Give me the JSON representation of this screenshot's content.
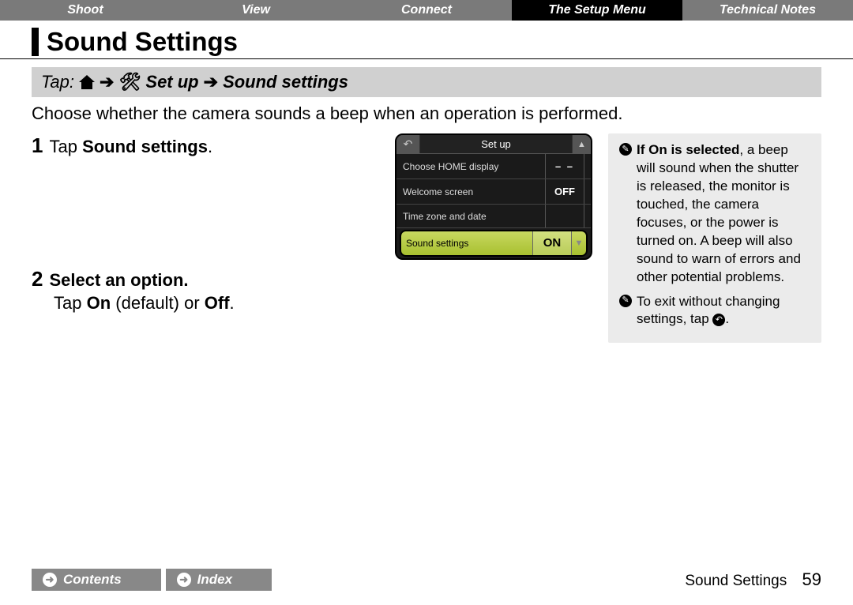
{
  "tabs": [
    "Shoot",
    "View",
    "Connect",
    "The Setup Menu",
    "Technical Notes"
  ],
  "active_tab": 3,
  "title": "Sound Settings",
  "path": {
    "prefix": "Tap:",
    "setup": "Set up",
    "target": "Sound settings"
  },
  "intro": "Choose whether the camera sounds a beep when an operation is performed.",
  "steps": [
    {
      "num": "1",
      "label_pre": "Tap ",
      "label_bold": "Sound settings",
      "label_post": "."
    },
    {
      "num": "2",
      "label_bold": "Select an option.",
      "sub_pre": "Tap ",
      "sub_b1": "On",
      "sub_mid": " (default) or ",
      "sub_b2": "Off",
      "sub_post": "."
    }
  ],
  "screenshot": {
    "title": "Set up",
    "rows": [
      {
        "label": "Choose HOME display",
        "value": "– –"
      },
      {
        "label": "Welcome screen",
        "value": "OFF"
      },
      {
        "label": "Time zone and date",
        "value": ""
      }
    ],
    "selected": {
      "label": "Sound settings",
      "value": "ON"
    }
  },
  "notes": {
    "n1_bold": "If On is selected",
    "n1_rest": ", a beep will sound when the shutter is released, the monitor is touched, the camera focuses, or the power is turned on. A beep will also sound to warn of errors and other potential problems.",
    "n2_pre": "To exit without changing settings, tap ",
    "n2_post": "."
  },
  "footer": {
    "contents": "Contents",
    "index": "Index",
    "section": "Sound Settings",
    "page": "59"
  }
}
